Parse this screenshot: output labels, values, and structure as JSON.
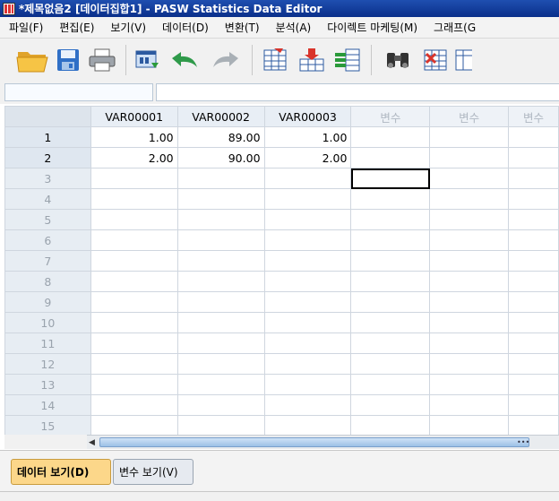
{
  "window": {
    "title": "*제목없음2 [데이터집합1] - PASW Statistics Data Editor"
  },
  "menu": [
    "파일(F)",
    "편집(E)",
    "보기(V)",
    "데이터(D)",
    "변환(T)",
    "분석(A)",
    "다이렉트 마케팅(M)",
    "그래프(G"
  ],
  "toolbar": {
    "icons": [
      "open-folder-icon",
      "save-icon",
      "print-icon",
      "dialog-recall-icon",
      "undo-icon",
      "redo-icon",
      "goto-case-icon",
      "goto-variable-icon",
      "variables-icon",
      "find-icon",
      "insert-cases-icon",
      "insert-variable-icon"
    ]
  },
  "cell_editor": {
    "reference": "",
    "value": ""
  },
  "grid": {
    "columns": [
      "VAR00001",
      "VAR00002",
      "VAR00003",
      "변수",
      "변수",
      "변수"
    ],
    "rows": [
      {
        "num": "1",
        "cells": [
          "1.00",
          "89.00",
          "1.00",
          "",
          "",
          ""
        ]
      },
      {
        "num": "2",
        "cells": [
          "2.00",
          "90.00",
          "2.00",
          "",
          "",
          ""
        ]
      },
      {
        "num": "3",
        "cells": [
          "",
          "",
          "",
          "",
          "",
          ""
        ]
      },
      {
        "num": "4",
        "cells": [
          "",
          "",
          "",
          "",
          "",
          ""
        ]
      },
      {
        "num": "5",
        "cells": [
          "",
          "",
          "",
          "",
          "",
          ""
        ]
      },
      {
        "num": "6",
        "cells": [
          "",
          "",
          "",
          "",
          "",
          ""
        ]
      },
      {
        "num": "7",
        "cells": [
          "",
          "",
          "",
          "",
          "",
          ""
        ]
      },
      {
        "num": "8",
        "cells": [
          "",
          "",
          "",
          "",
          "",
          ""
        ]
      },
      {
        "num": "9",
        "cells": [
          "",
          "",
          "",
          "",
          "",
          ""
        ]
      },
      {
        "num": "10",
        "cells": [
          "",
          "",
          "",
          "",
          "",
          ""
        ]
      },
      {
        "num": "11",
        "cells": [
          "",
          "",
          "",
          "",
          "",
          ""
        ]
      },
      {
        "num": "12",
        "cells": [
          "",
          "",
          "",
          "",
          "",
          ""
        ]
      },
      {
        "num": "13",
        "cells": [
          "",
          "",
          "",
          "",
          "",
          ""
        ]
      },
      {
        "num": "14",
        "cells": [
          "",
          "",
          "",
          "",
          "",
          ""
        ]
      },
      {
        "num": "15",
        "cells": [
          "",
          "",
          "",
          "",
          "",
          ""
        ]
      }
    ]
  },
  "tabs": {
    "data_view": "데이터 보기(D)",
    "variable_view": "변수 보기(V)"
  }
}
